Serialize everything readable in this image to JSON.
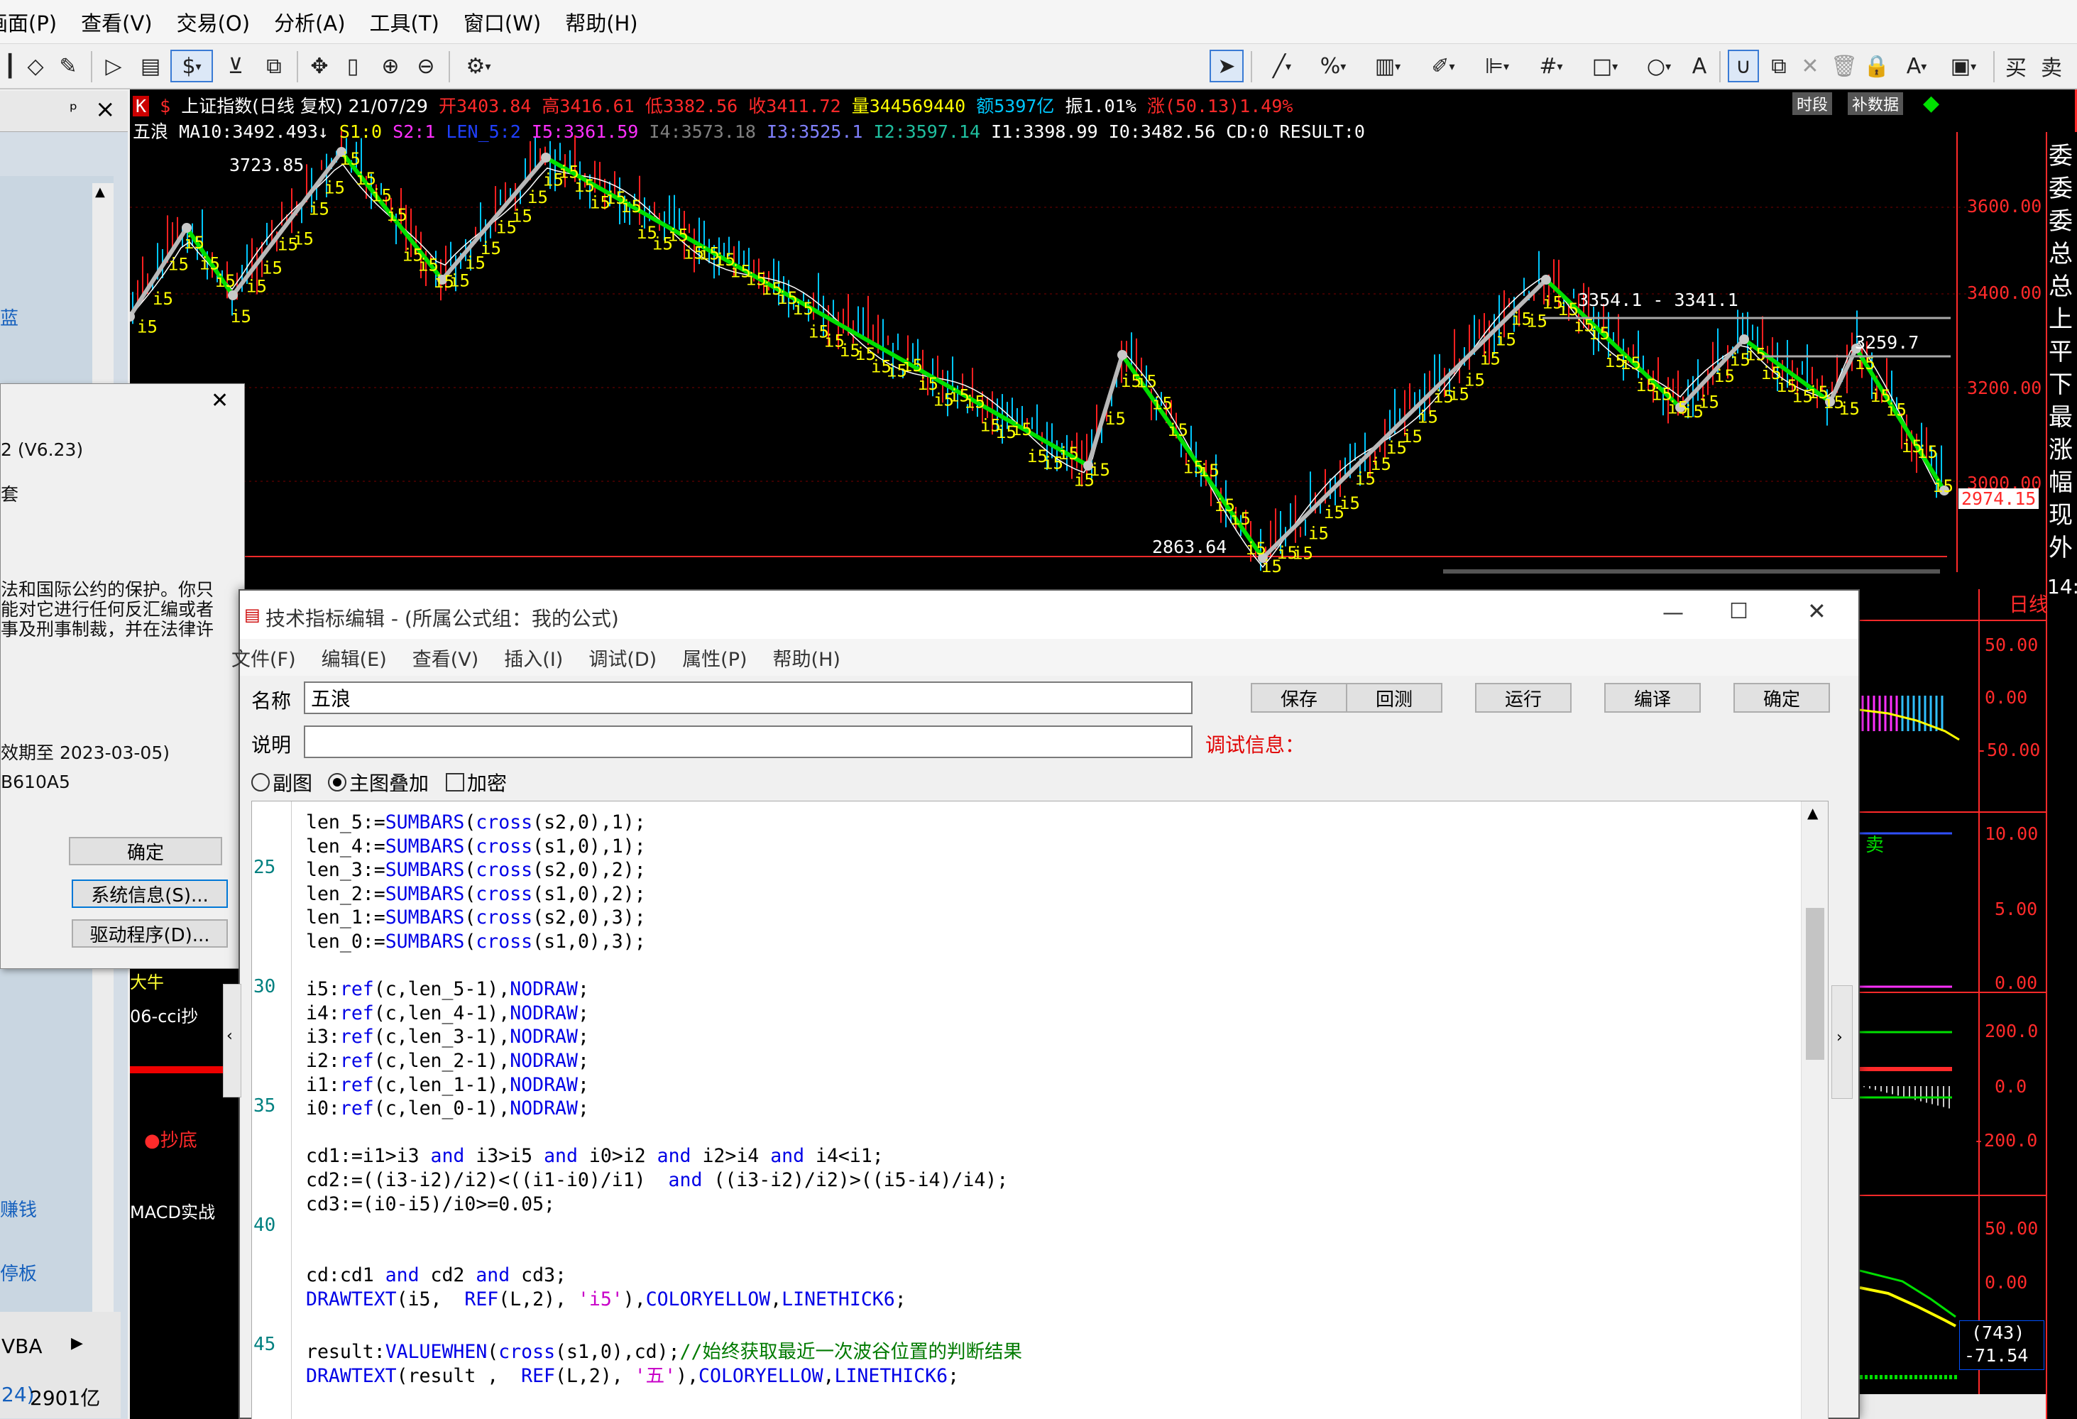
{
  "menubar": {
    "items": [
      "画面(P)",
      "查看(V)",
      "交易(O)",
      "分析(A)",
      "工具(T)",
      "窗口(W)",
      "帮助(H)"
    ]
  },
  "toolbar": {
    "currency_symbol": "$",
    "right_labels": [
      "买",
      "卖"
    ]
  },
  "left_panel": {
    "pin_glyph": "ᵖ",
    "close_glyph": "×",
    "items": [
      "蓝",
      "赚钱",
      "停板"
    ],
    "bottom_tab": "VBA",
    "status_left": "24)",
    "status_amount": "2901亿"
  },
  "about_dialog": {
    "version": "2 (V6.23)",
    "line_a": "套",
    "legal_lines": [
      "法和国际公约的保护。你只",
      "能对它进行任何反汇编或者",
      "事及刑事制裁，并在法律许"
    ],
    "expiry": "效期至 2023-03-05)",
    "code": "B610A5",
    "ok_label": "确定",
    "sysinfo_label": "系统信息(S)...",
    "driver_label": "驱动程序(D)..."
  },
  "chart": {
    "header_line1": {
      "title": "上证指数(日线 复权) 21/07/29",
      "open": "开3403.84",
      "high": "高3416.61",
      "low": "低3382.56",
      "close": "收3411.72",
      "volume": "量344569440",
      "amount": "额5397亿",
      "amplitude": "振1.01%",
      "change": "涨(50.13)1.49%"
    },
    "header_line2": {
      "name": "五浪",
      "ma10": "MA10:3492.493↓",
      "s1": "S1:0",
      "s2": "S2:1",
      "len5": "LEN_5:2",
      "i5": "I5:3361.59",
      "i4": "I4:3573.18",
      "i3": "I3:3525.1",
      "i2": "I2:3597.14",
      "i1": "I1:3398.99",
      "i0": "I0:3482.56",
      "cd": "CD:0",
      "result": "RESULT:0"
    },
    "badges": [
      "时段",
      "补数据"
    ],
    "price_labels": [
      "3600.00",
      "3400.00",
      "3200.00",
      "3000.00"
    ],
    "high_label": "3723.85",
    "low_label": "2863.64",
    "range_label": "3354.1 - 3341.1",
    "level_label": "3259.7",
    "last_price": "2974.15",
    "marker_label": "i5",
    "colors": {
      "wave": "#00e000",
      "price_up": "#ff2020",
      "price_down": "#00c8ff",
      "marker": "#ffff00",
      "axis": "#ff2a2a"
    }
  },
  "right_panel": {
    "side_chars": [
      "委",
      "委",
      "委",
      "总",
      "总",
      "上",
      "平",
      "下",
      "最",
      "涨",
      "幅",
      "现",
      "外"
    ],
    "period_label": "日线",
    "time_label": "14:",
    "sub_axes": [
      {
        "labels": [
          "50.00",
          "0.00",
          "-50.00"
        ]
      },
      {
        "labels": [
          "10.00",
          "5.00",
          "0.00"
        ]
      },
      {
        "labels": [
          "200.0",
          "0.0",
          "-200.0"
        ]
      },
      {
        "labels": [
          "50.00",
          "0.00"
        ]
      }
    ],
    "bottom_value1": "(743)",
    "bottom_value2": "-71.54",
    "sell_label": "卖"
  },
  "sub_windows": {
    "labels": [
      "大牛",
      "06-cci抄",
      "抄底",
      "MACD实战"
    ]
  },
  "editor": {
    "title": "技术指标编辑 - (所属公式组：我的公式)",
    "menu": [
      "文件(F)",
      "编辑(E)",
      "查看(V)",
      "插入(I)",
      "调试(D)",
      "属性(P)",
      "帮助(H)"
    ],
    "name_label": "名称",
    "name_value": "五浪",
    "desc_label": "说明",
    "desc_value": "",
    "debug_label": "调试信息：",
    "buttons": {
      "save": "保存",
      "back": "回测",
      "run": "运行",
      "compile": "编译",
      "ok": "确定"
    },
    "options": {
      "sub": "副图",
      "main": "主图叠加",
      "encrypt": "加密"
    },
    "line_numbers": [
      "25",
      "30",
      "35",
      "40",
      "45"
    ],
    "code_lines": [
      [
        [
          "len_5:=",
          ""
        ],
        [
          "SUMBARS",
          "kw"
        ],
        [
          "(",
          ""
        ],
        [
          "cross",
          "kw"
        ],
        [
          "(s2,0),1);",
          ""
        ]
      ],
      [
        [
          "len_4:=",
          ""
        ],
        [
          "SUMBARS",
          "kw"
        ],
        [
          "(",
          ""
        ],
        [
          "cross",
          "kw"
        ],
        [
          "(s1,0),1);",
          ""
        ]
      ],
      [
        [
          "len_3:=",
          ""
        ],
        [
          "SUMBARS",
          "kw"
        ],
        [
          "(",
          ""
        ],
        [
          "cross",
          "kw"
        ],
        [
          "(s2,0),2);",
          ""
        ]
      ],
      [
        [
          "len_2:=",
          ""
        ],
        [
          "SUMBARS",
          "kw"
        ],
        [
          "(",
          ""
        ],
        [
          "cross",
          "kw"
        ],
        [
          "(s1,0),2);",
          ""
        ]
      ],
      [
        [
          "len_1:=",
          ""
        ],
        [
          "SUMBARS",
          "kw"
        ],
        [
          "(",
          ""
        ],
        [
          "cross",
          "kw"
        ],
        [
          "(s2,0),3);",
          ""
        ]
      ],
      [
        [
          "len_0:=",
          ""
        ],
        [
          "SUMBARS",
          "kw"
        ],
        [
          "(",
          ""
        ],
        [
          "cross",
          "kw"
        ],
        [
          "(s1,0),3);",
          ""
        ]
      ],
      [],
      [
        [
          "i5:",
          ""
        ],
        [
          "ref",
          "kw"
        ],
        [
          "(c,len_5-1),",
          ""
        ],
        [
          "NODRAW",
          "kw"
        ],
        [
          ";",
          ""
        ]
      ],
      [
        [
          "i4:",
          ""
        ],
        [
          "ref",
          "kw"
        ],
        [
          "(c,len_4-1),",
          ""
        ],
        [
          "NODRAW",
          "kw"
        ],
        [
          ";",
          ""
        ]
      ],
      [
        [
          "i3:",
          ""
        ],
        [
          "ref",
          "kw"
        ],
        [
          "(c,len_3-1),",
          ""
        ],
        [
          "NODRAW",
          "kw"
        ],
        [
          ";",
          ""
        ]
      ],
      [
        [
          "i2:",
          ""
        ],
        [
          "ref",
          "kw"
        ],
        [
          "(c,len_2-1),",
          ""
        ],
        [
          "NODRAW",
          "kw"
        ],
        [
          ";",
          ""
        ]
      ],
      [
        [
          "i1:",
          ""
        ],
        [
          "ref",
          "kw"
        ],
        [
          "(c,len_1-1),",
          ""
        ],
        [
          "NODRAW",
          "kw"
        ],
        [
          ";",
          ""
        ]
      ],
      [
        [
          "i0:",
          ""
        ],
        [
          "ref",
          "kw"
        ],
        [
          "(c,len_0-1),",
          ""
        ],
        [
          "NODRAW",
          "kw"
        ],
        [
          ";",
          ""
        ]
      ],
      [],
      [
        [
          "cd1:=i1>i3 ",
          ""
        ],
        [
          "and",
          "kw"
        ],
        [
          " i3>i5 ",
          ""
        ],
        [
          "and",
          "kw"
        ],
        [
          " i0>i2 ",
          ""
        ],
        [
          "and",
          "kw"
        ],
        [
          " i2>i4 ",
          ""
        ],
        [
          "and",
          "kw"
        ],
        [
          " i4<i1;",
          ""
        ]
      ],
      [
        [
          "cd2:=((i3-i2)/i2)<((i1-i0)/i1)  ",
          ""
        ],
        [
          "and",
          "kw"
        ],
        [
          " ((i3-i2)/i2)>((i5-i4)/i4);",
          ""
        ]
      ],
      [
        [
          "cd3:=(i0-i5)/i0>=0.05;",
          ""
        ]
      ],
      [],
      [],
      [
        [
          "cd:cd1 ",
          ""
        ],
        [
          "and",
          "kw"
        ],
        [
          " cd2 ",
          ""
        ],
        [
          "and",
          "kw"
        ],
        [
          " cd3;",
          ""
        ]
      ],
      [
        [
          "DRAWTEXT",
          "kw"
        ],
        [
          "(i5,  ",
          ""
        ],
        [
          "REF",
          "kw"
        ],
        [
          "(L,2), ",
          ""
        ],
        [
          "'i5'",
          "st"
        ],
        [
          "),",
          ""
        ],
        [
          "COLORYELLOW",
          "kw"
        ],
        [
          ",",
          ""
        ],
        [
          "LINETHICK6",
          "kw"
        ],
        [
          ";",
          ""
        ]
      ],
      [],
      [
        [
          "result:",
          ""
        ],
        [
          "VALUEWHEN",
          "kw"
        ],
        [
          "(",
          ""
        ],
        [
          "cross",
          "kw"
        ],
        [
          "(s1,0),cd);",
          ""
        ],
        [
          "//始终获取最近一次波谷位置的判断结果",
          "cm"
        ]
      ],
      [
        [
          "DRAWTEXT",
          "kw"
        ],
        [
          "(result ,  ",
          ""
        ],
        [
          "REF",
          "kw"
        ],
        [
          "(L,2), ",
          ""
        ],
        [
          "'五'",
          "st"
        ],
        [
          "),",
          ""
        ],
        [
          "COLORYELLOW",
          "kw"
        ],
        [
          ",",
          ""
        ],
        [
          "LINETHICK6",
          "kw"
        ],
        [
          ";",
          ""
        ]
      ]
    ]
  }
}
